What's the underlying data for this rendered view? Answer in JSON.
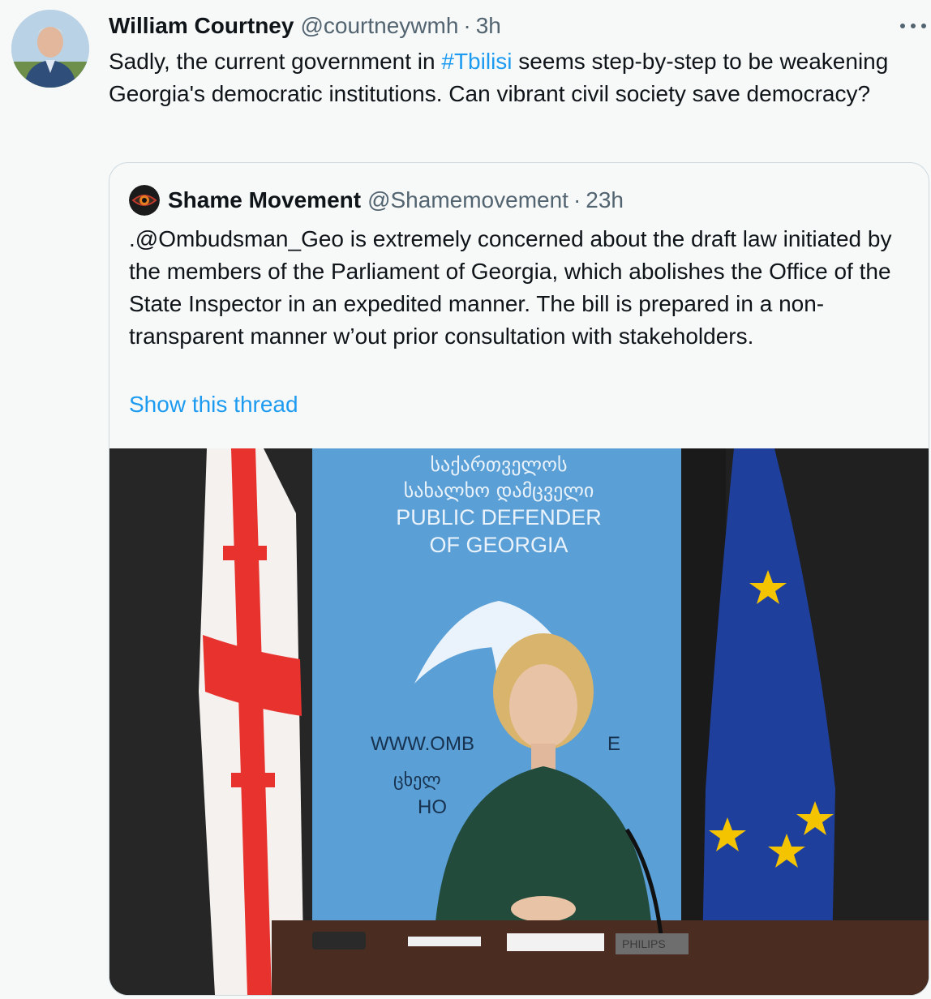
{
  "tweet": {
    "author_name": "William Courtney",
    "author_handle": "@courtneywmh",
    "separator": "·",
    "time": "3h",
    "text_before": "Sadly, the current government in ",
    "hashtag": "#Tbilisi",
    "text_after": " seems step-by-step to be weakening Georgia's democratic institutions.  Can vibrant civil society save democracy?",
    "avatar_icon": "user-avatar",
    "more_icon": "more-dots-icon"
  },
  "quote": {
    "author_name": "Shame Movement",
    "author_handle": "@Shamemovement",
    "separator": "·",
    "time": "23h",
    "avatar_icon": "eye-logo",
    "text": ".@Ombudsman_Geo is extremely concerned about the draft law initiated by the members of the Parliament of Georgia, which abolishes the Office of the State Inspector in an expedited manner. The bill is prepared in a non-transparent manner w’out prior consultation with stakeholders.",
    "show_thread": "Show this thread"
  },
  "photo": {
    "banner_line1": "საქართველოს",
    "banner_line2": "სახალხო დამცველი",
    "banner_line3": "PUBLIC DEFENDER",
    "banner_line4": "OF GEORGIA",
    "banner_url": "WWW.OMB",
    "banner_url_end": "E",
    "banner_georgian_partial": "ცხელ",
    "banner_hot_partial": "HO",
    "mic_brand": "PHILIPS"
  },
  "colors": {
    "link": "#1d9bf0",
    "secondary_text": "#536471",
    "border": "#cfd9de",
    "banner_blue": "#5a9fd6",
    "eu_blue": "#1f3f9c",
    "georgia_red": "#e8322e"
  }
}
